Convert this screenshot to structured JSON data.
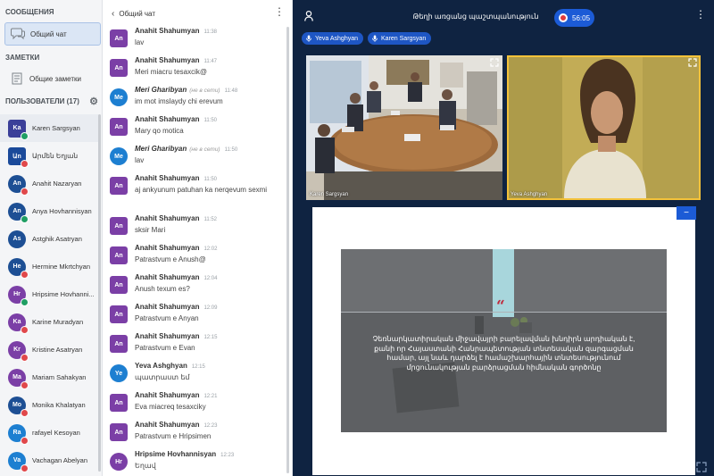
{
  "sidebar": {
    "messages_title": "СООБЩЕНИЯ",
    "general_chat": "Общий чат",
    "notes_title": "ЗАМЕТКИ",
    "general_notes": "Общие заметки",
    "users_title": "ПОЛЬЗОВАТЕЛИ (17)",
    "users": [
      {
        "initials": "Ka",
        "name": "Karen Sargsyan",
        "color": "#3b3f99",
        "badge": "green",
        "square": true
      },
      {
        "initials": "Աn",
        "name": "Արմեն Եղյան",
        "color": "#1b4a9a",
        "badge": "red",
        "square": true
      },
      {
        "initials": "An",
        "name": "Anahit Nazaryan",
        "color": "#1d4f94",
        "badge": "red",
        "square": false
      },
      {
        "initials": "An",
        "name": "Anya Hovhannisyan",
        "color": "#1d4f94",
        "badge": "green",
        "square": false
      },
      {
        "initials": "As",
        "name": "Astghik Asatryan",
        "color": "#1d4f94",
        "badge": "none",
        "square": false
      },
      {
        "initials": "He",
        "name": "Hermine Mkrtchyan",
        "color": "#1d4f94",
        "badge": "red",
        "square": false
      },
      {
        "initials": "Hr",
        "name": "Hripsime Hovhanni...",
        "color": "#7b3fa6",
        "badge": "green",
        "square": false
      },
      {
        "initials": "Ka",
        "name": "Karine Muradyan",
        "color": "#7b3fa6",
        "badge": "red",
        "square": false
      },
      {
        "initials": "Kr",
        "name": "Kristine Asatryan",
        "color": "#7b3fa6",
        "badge": "red",
        "square": false
      },
      {
        "initials": "Ma",
        "name": "Mariam Sahakyan",
        "color": "#7b3fa6",
        "badge": "red",
        "square": false
      },
      {
        "initials": "Mo",
        "name": "Monika Khalatyan",
        "color": "#1d4f94",
        "badge": "red",
        "square": false
      },
      {
        "initials": "Ra",
        "name": "rafayel Kesoyan",
        "color": "#1d7fd1",
        "badge": "red",
        "square": false
      },
      {
        "initials": "Va",
        "name": "Vachagan Abelyan",
        "color": "#1d7fd1",
        "badge": "red",
        "square": false
      }
    ]
  },
  "chat": {
    "title": "Общий чат",
    "messages": [
      {
        "initials": "An",
        "color": "#7b3fa6",
        "author": "Anahit Shahumyan",
        "note": "",
        "time": "11:38",
        "text": "lav",
        "guest": false,
        "tall": false
      },
      {
        "initials": "An",
        "color": "#7b3fa6",
        "author": "Anahit Shahumyan",
        "note": "",
        "time": "11:47",
        "text": "Meri miacru tesaxcik@",
        "guest": false,
        "tall": false
      },
      {
        "initials": "Me",
        "color": "#1d7fd1",
        "author": "Meri Gharibyan",
        "note": "(не в сети)",
        "time": "11:48",
        "text": "im mot imslaydy chi erevum",
        "guest": true,
        "tall": false
      },
      {
        "initials": "An",
        "color": "#7b3fa6",
        "author": "Anahit Shahumyan",
        "note": "",
        "time": "11:50",
        "text": "Mary qo motica",
        "guest": false,
        "tall": false
      },
      {
        "initials": "Me",
        "color": "#1d7fd1",
        "author": "Meri Gharibyan",
        "note": "(не в сети)",
        "time": "11:50",
        "text": "lav",
        "guest": true,
        "tall": false
      },
      {
        "initials": "An",
        "color": "#7b3fa6",
        "author": "Anahit Shahumyan",
        "note": "",
        "time": "11:50",
        "text": "aj ankyunum patuhan ka nerqevum sexmi",
        "guest": false,
        "tall": true
      },
      {
        "initials": "An",
        "color": "#7b3fa6",
        "author": "Anahit Shahumyan",
        "note": "",
        "time": "11:52",
        "text": "sksir Mari",
        "guest": false,
        "tall": false
      },
      {
        "initials": "An",
        "color": "#7b3fa6",
        "author": "Anahit Shahumyan",
        "note": "",
        "time": "12:02",
        "text": "Patrastvum e Anush@",
        "guest": false,
        "tall": false
      },
      {
        "initials": "An",
        "color": "#7b3fa6",
        "author": "Anahit Shahumyan",
        "note": "",
        "time": "12:04",
        "text": "Anush texum es?",
        "guest": false,
        "tall": false
      },
      {
        "initials": "An",
        "color": "#7b3fa6",
        "author": "Anahit Shahumyan",
        "note": "",
        "time": "12:09",
        "text": "Patrastvum e Anyan",
        "guest": false,
        "tall": false
      },
      {
        "initials": "An",
        "color": "#7b3fa6",
        "author": "Anahit Shahumyan",
        "note": "",
        "time": "12:15",
        "text": "Patrastvum e Evan",
        "guest": false,
        "tall": false
      },
      {
        "initials": "Ye",
        "color": "#1d7fd1",
        "author": "Yeva Ashghyan",
        "note": "",
        "time": "12:15",
        "text": "պատրաստ եմ",
        "guest": false,
        "tall": false
      },
      {
        "initials": "An",
        "color": "#7b3fa6",
        "author": "Anahit Shahumyan",
        "note": "",
        "time": "12:21",
        "text": "Eva miacreq tesaxciky",
        "guest": false,
        "tall": false
      },
      {
        "initials": "An",
        "color": "#7b3fa6",
        "author": "Anahit Shahumyan",
        "note": "",
        "time": "12:23",
        "text": "Patrastvum e Hripsimen",
        "guest": false,
        "tall": false
      },
      {
        "initials": "Hr",
        "color": "#7b3fa6",
        "author": "Hripsime Hovhannisyan",
        "note": "",
        "time": "12:23",
        "text": "Եղավ",
        "guest": false,
        "tall": false
      }
    ]
  },
  "conference": {
    "title": "Թեղի առցանց պաշտպանություն",
    "timer": "56:05",
    "speakers": [
      "Yeva Ashghyan",
      "Karen Sargsyan"
    ],
    "video_left_label": "Karen Sargsyan",
    "video_right_label": "Yeva Ashghyan",
    "slide_text": "Չեռնարկատիրական միջավայրի բարելավման խնդիրն արդիական է, քանի որ Հայաստանի Հանրապետության տնտեսական զարգացման համար, այլ նաև դարձել է համաշխարհային տնտեսությունում մրցունակության բարձրացման հիմնական գործոնը",
    "accent": "#1c5bd6",
    "highlight": "#f3c23a"
  }
}
